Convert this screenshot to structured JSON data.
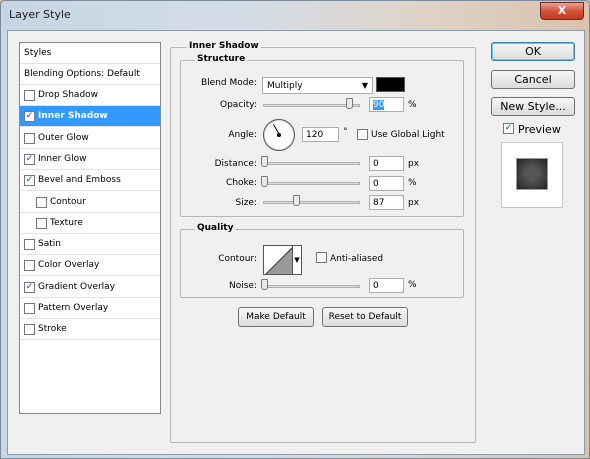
{
  "window": {
    "title": "Layer Style",
    "close_glyph": "X"
  },
  "styles_list": {
    "header": "Styles",
    "blending": "Blending Options: Default",
    "items": [
      {
        "label": "Drop Shadow",
        "checked": false,
        "selected": false
      },
      {
        "label": "Inner Shadow",
        "checked": true,
        "selected": true
      },
      {
        "label": "Outer Glow",
        "checked": false,
        "selected": false
      },
      {
        "label": "Inner Glow",
        "checked": true,
        "selected": false
      },
      {
        "label": "Bevel and Emboss",
        "checked": true,
        "selected": false
      },
      {
        "label": "Contour",
        "checked": false,
        "selected": false
      },
      {
        "label": "Texture",
        "checked": false,
        "selected": false
      },
      {
        "label": "Satin",
        "checked": false,
        "selected": false
      },
      {
        "label": "Color Overlay",
        "checked": false,
        "selected": false
      },
      {
        "label": "Gradient Overlay",
        "checked": true,
        "selected": false
      },
      {
        "label": "Pattern Overlay",
        "checked": false,
        "selected": false
      },
      {
        "label": "Stroke",
        "checked": false,
        "selected": false
      }
    ]
  },
  "panel": {
    "title": "Inner Shadow",
    "structure": {
      "title": "Structure",
      "blend_mode_label": "Blend Mode:",
      "blend_mode_value": "Multiply",
      "shadow_color": "#000000",
      "opacity_label": "Opacity:",
      "opacity_value": "90",
      "opacity_unit": "%",
      "opacity_fraction": 0.9,
      "angle_label": "Angle:",
      "angle_value": "120",
      "angle_unit": "°",
      "use_global_light_label": "Use Global Light",
      "use_global_light": false,
      "distance_label": "Distance:",
      "distance_value": "0",
      "distance_unit": "px",
      "choke_label": "Choke:",
      "choke_value": "0",
      "choke_unit": "%",
      "size_label": "Size:",
      "size_value": "87",
      "size_unit": "px",
      "size_fraction": 0.35
    },
    "quality": {
      "title": "Quality",
      "contour_label": "Contour:",
      "anti_aliased_label": "Anti-aliased",
      "anti_aliased": false,
      "noise_label": "Noise:",
      "noise_value": "0",
      "noise_unit": "%"
    },
    "make_default": "Make Default",
    "reset_default": "Reset to Default"
  },
  "buttons": {
    "ok": "OK",
    "cancel": "Cancel",
    "new_style": "New Style...",
    "preview_label": "Preview",
    "preview_checked": true
  },
  "colors": {
    "selection": "#3399ff",
    "check": "#1a3f7a"
  }
}
